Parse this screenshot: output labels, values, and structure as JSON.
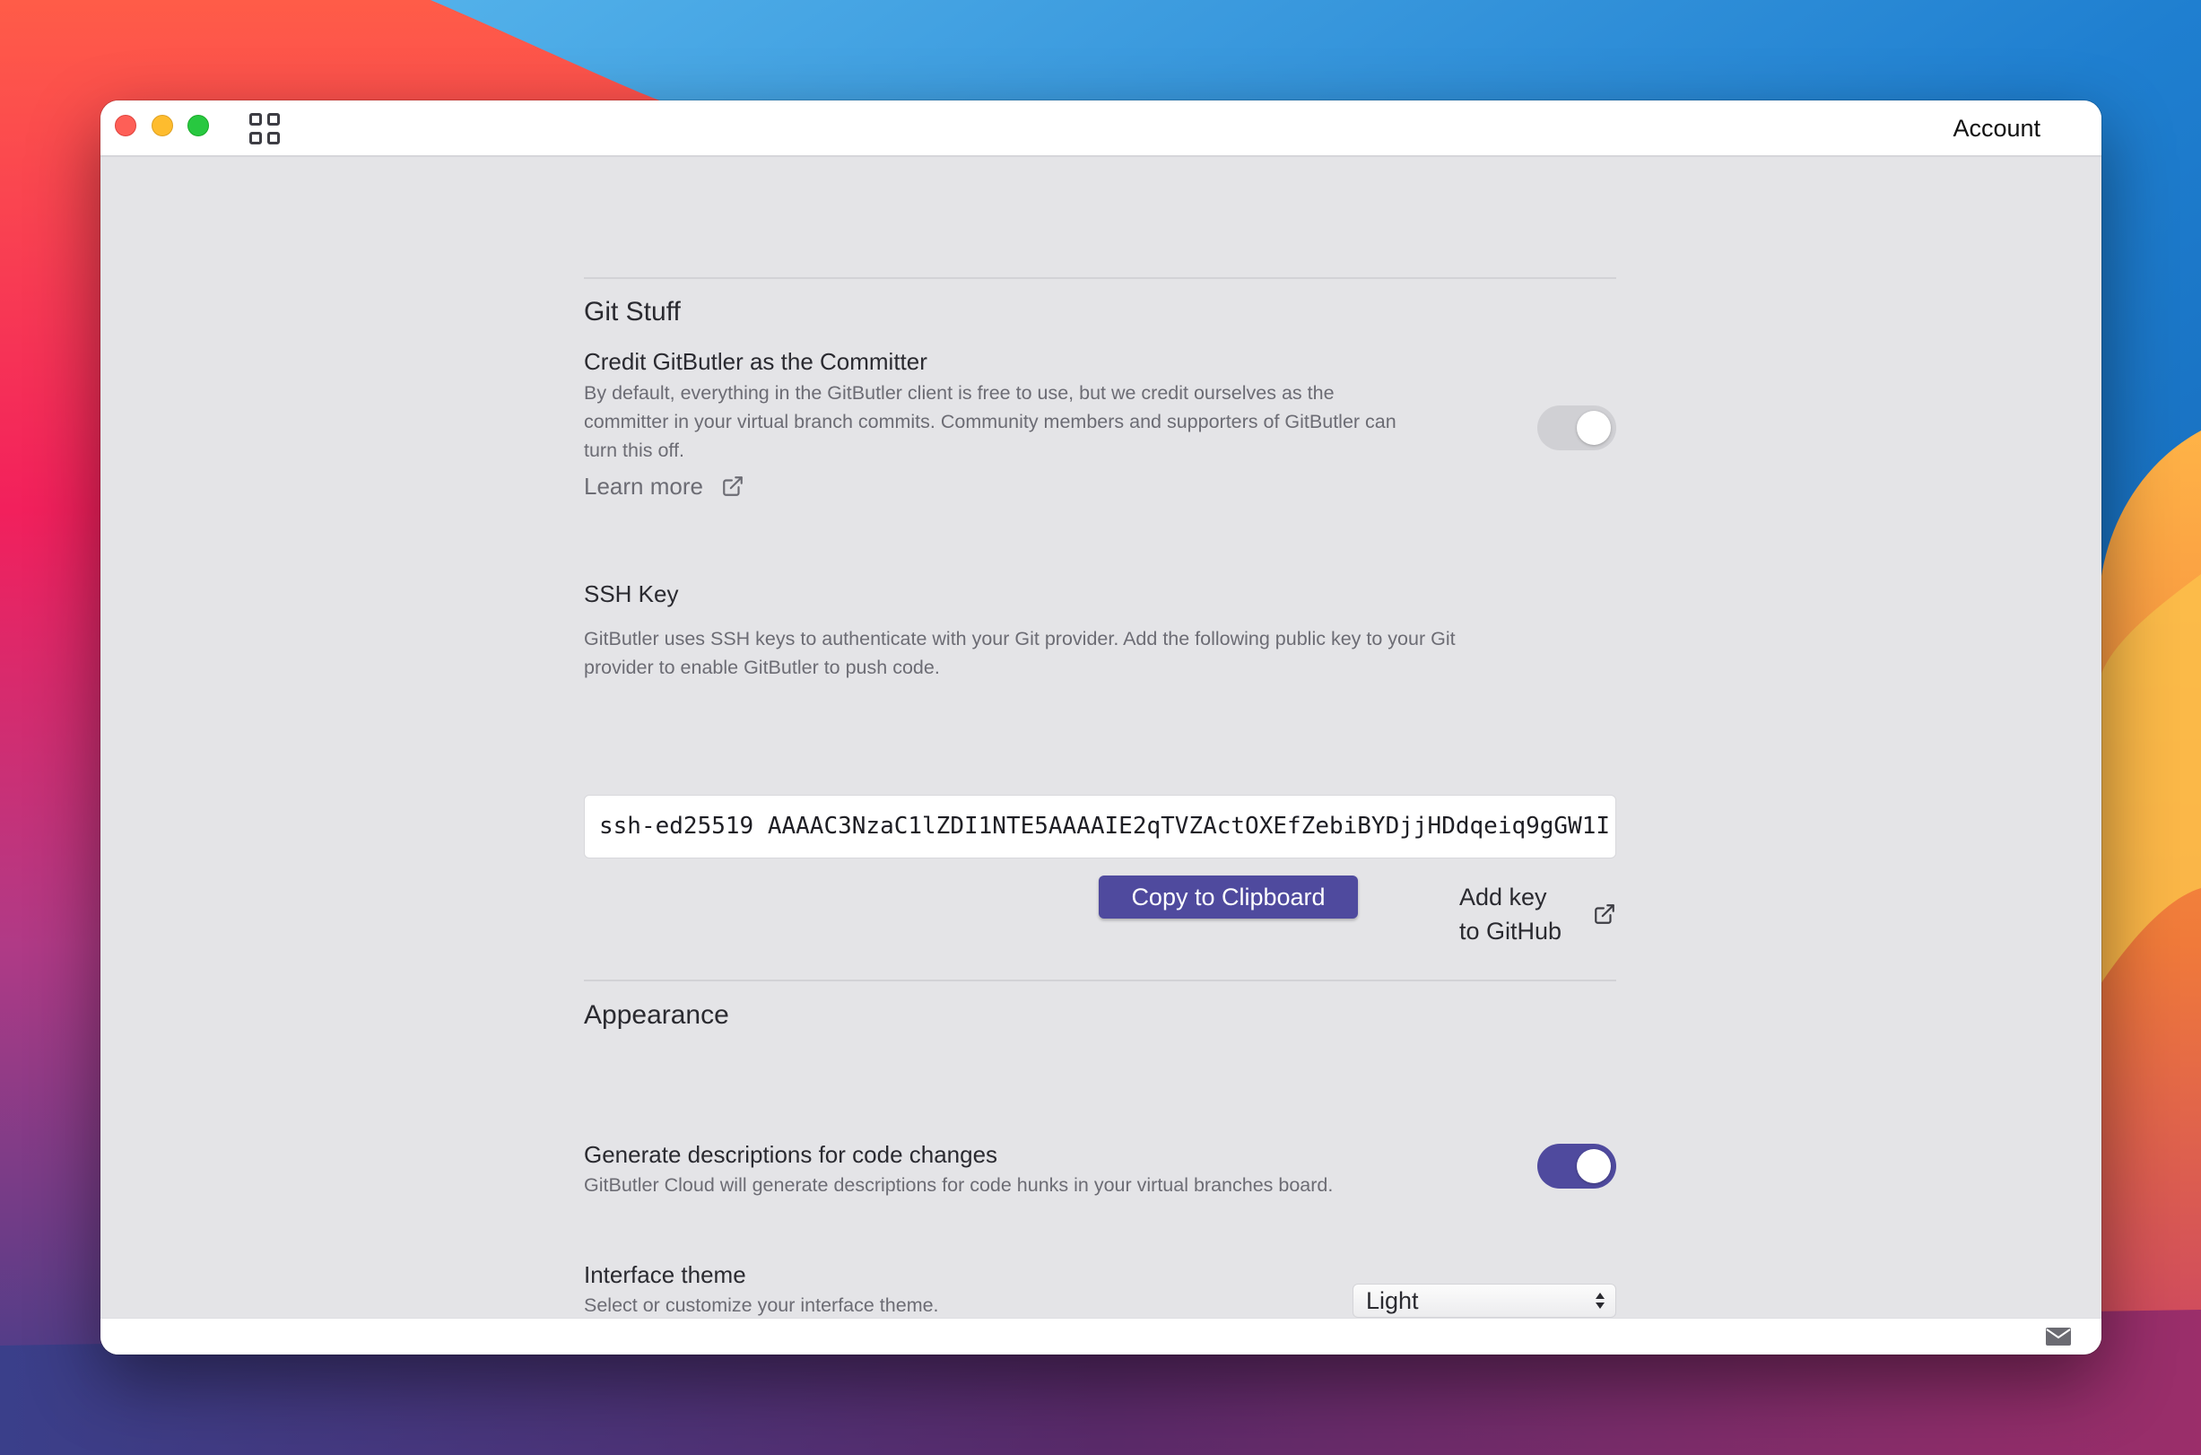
{
  "window": {
    "header_link": "Account"
  },
  "git_stuff": {
    "title": "Git Stuff",
    "credit": {
      "title": "Credit GitButler as the Committer",
      "description_lines": [
        "By default, everything in the GitButler client is free to use, but we credit ourselves as the",
        "committer in your virtual branch commits. Community members and supporters of GitButler can",
        "turn this off."
      ],
      "enabled": false,
      "learn_more_label": "Learn more"
    },
    "ssh": {
      "title": "SSH Key",
      "description_lines": [
        "GitButler uses SSH keys to authenticate with your Git provider. Add the following public key to your Git",
        "provider to enable GitButler to push code."
      ],
      "key_value": "ssh-ed25519 AAAAC3NzaC1lZDI1NTE5AAAAIE2qTVZActOXEfZebiBYDjjHDdqeiq9gGW1I",
      "copy_label": "Copy to Clipboard",
      "add_key_label": "Add key to GitHub"
    }
  },
  "appearance": {
    "title": "Appearance",
    "descriptions": {
      "title": "Generate descriptions for code changes",
      "description": "GitButler Cloud will generate descriptions for code hunks in your virtual branches board.",
      "enabled": true
    },
    "theme": {
      "title": "Interface theme",
      "description": "Select or customize your interface theme.",
      "selected": "Light"
    }
  },
  "colors": {
    "accent": "#4f4a9e",
    "toggle_off": "#d0d0d4",
    "panel_bg": "#e4e4e7"
  },
  "icons": {
    "external_link": "external-link-icon",
    "mail": "mail-icon",
    "grid": "grid-icon"
  }
}
